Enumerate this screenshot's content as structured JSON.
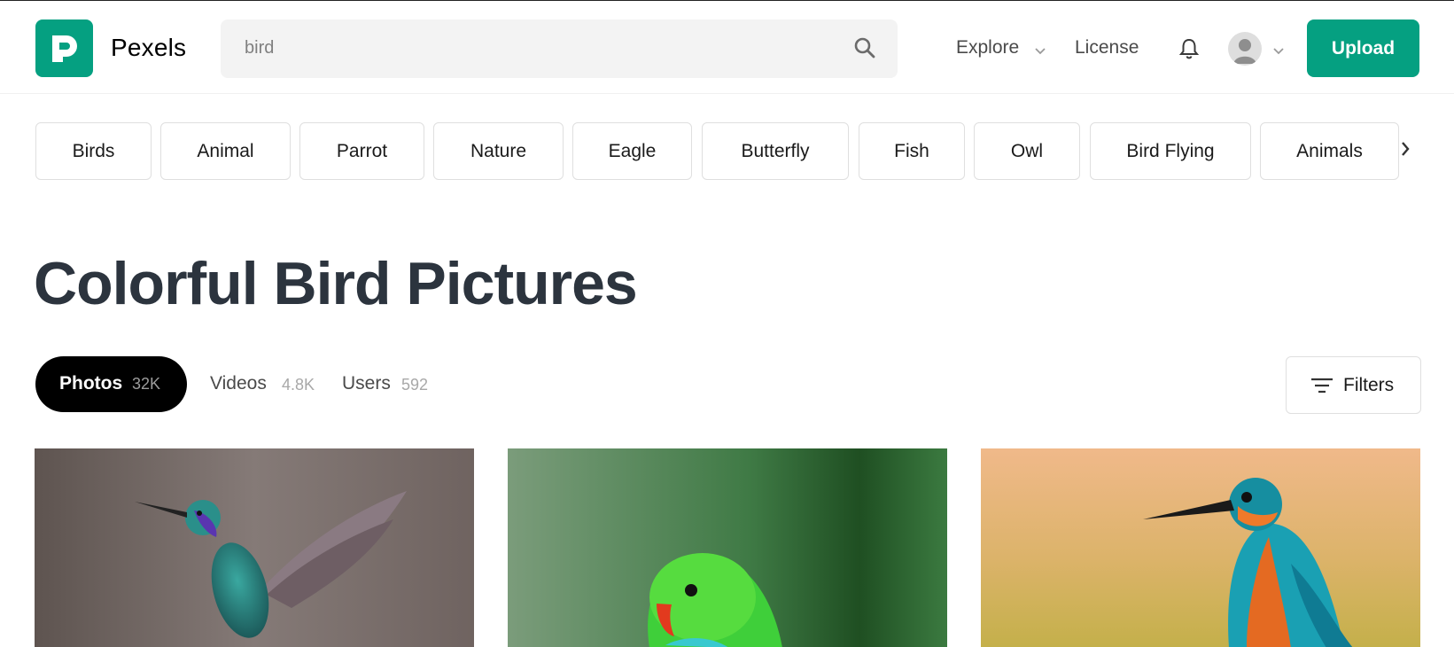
{
  "header": {
    "logo_text": "Pexels",
    "search_value": "bird",
    "explore_label": "Explore",
    "license_label": "License",
    "upload_label": "Upload"
  },
  "chips": [
    "Birds",
    "Animal",
    "Parrot",
    "Nature",
    "Eagle",
    "Butterfly",
    "Fish",
    "Owl",
    "Bird Flying",
    "Animals"
  ],
  "page_title": "Colorful Bird Pictures",
  "tabs": [
    {
      "label": "Photos",
      "count": "32K"
    },
    {
      "label": "Videos",
      "count": "4.8K"
    },
    {
      "label": "Users",
      "count": "592"
    }
  ],
  "filters_label": "Filters",
  "photos": [
    {
      "subject": "hummingbird"
    },
    {
      "subject": "green parrot"
    },
    {
      "subject": "kingfisher"
    }
  ],
  "colors": {
    "brand": "#05a081",
    "title": "#2c343e",
    "active_tab": "#000000"
  }
}
